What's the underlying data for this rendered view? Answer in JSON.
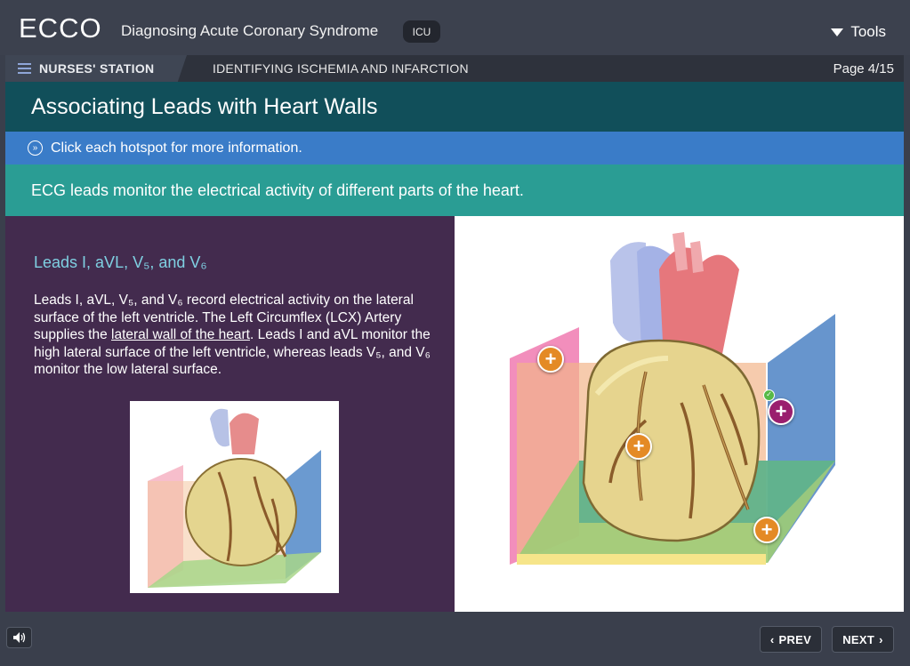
{
  "header": {
    "logo": "ECCO",
    "course_title": "Diagnosing Acute Coronary Syndrome",
    "badge": "ICU",
    "tools_label": "Tools"
  },
  "nav": {
    "station_label": "NURSES' STATION",
    "section_label": "IDENTIFYING ISCHEMIA AND INFARCTION",
    "page_label": "Page 4/15"
  },
  "page": {
    "title": "Associating Leads with Heart Walls",
    "instruction": "Click each hotspot for more information.",
    "intro": "ECG leads monitor the electrical activity of different parts of the heart."
  },
  "info": {
    "heading": "Leads I, aVL, V₅, and V₆",
    "body_part1": "Leads I, aVL, V₅, and V₆ record electrical activity on the lateral surface of the left ventricle. The Left Circumflex (LCX) Artery supplies the ",
    "body_link": "lateral wall of the heart",
    "body_part2": ". Leads I and aVL monitor the high lateral surface of the left ventricle, whereas leads V₅, and V₆ monitor the low lateral surface."
  },
  "hotspots": [
    {
      "name": "hotspot-left-wall",
      "color": "orange",
      "symbol": "+",
      "visited": false
    },
    {
      "name": "hotspot-anterior-wall",
      "color": "orange",
      "symbol": "+",
      "visited": false
    },
    {
      "name": "hotspot-lateral-wall",
      "color": "magenta",
      "symbol": "+",
      "visited": true
    },
    {
      "name": "hotspot-inferior-wall",
      "color": "orange",
      "symbol": "+",
      "visited": false
    }
  ],
  "footer": {
    "prev_label": "PREV",
    "next_label": "NEXT"
  },
  "colors": {
    "title_bar": "#114f5a",
    "instruction_bar": "#3a7cc8",
    "intro_bar": "#2a9d94",
    "info_panel": "#432b4e",
    "info_heading": "#7fd0e2",
    "hotspot_orange": "#e48a25",
    "hotspot_magenta": "#9a1f6e"
  }
}
